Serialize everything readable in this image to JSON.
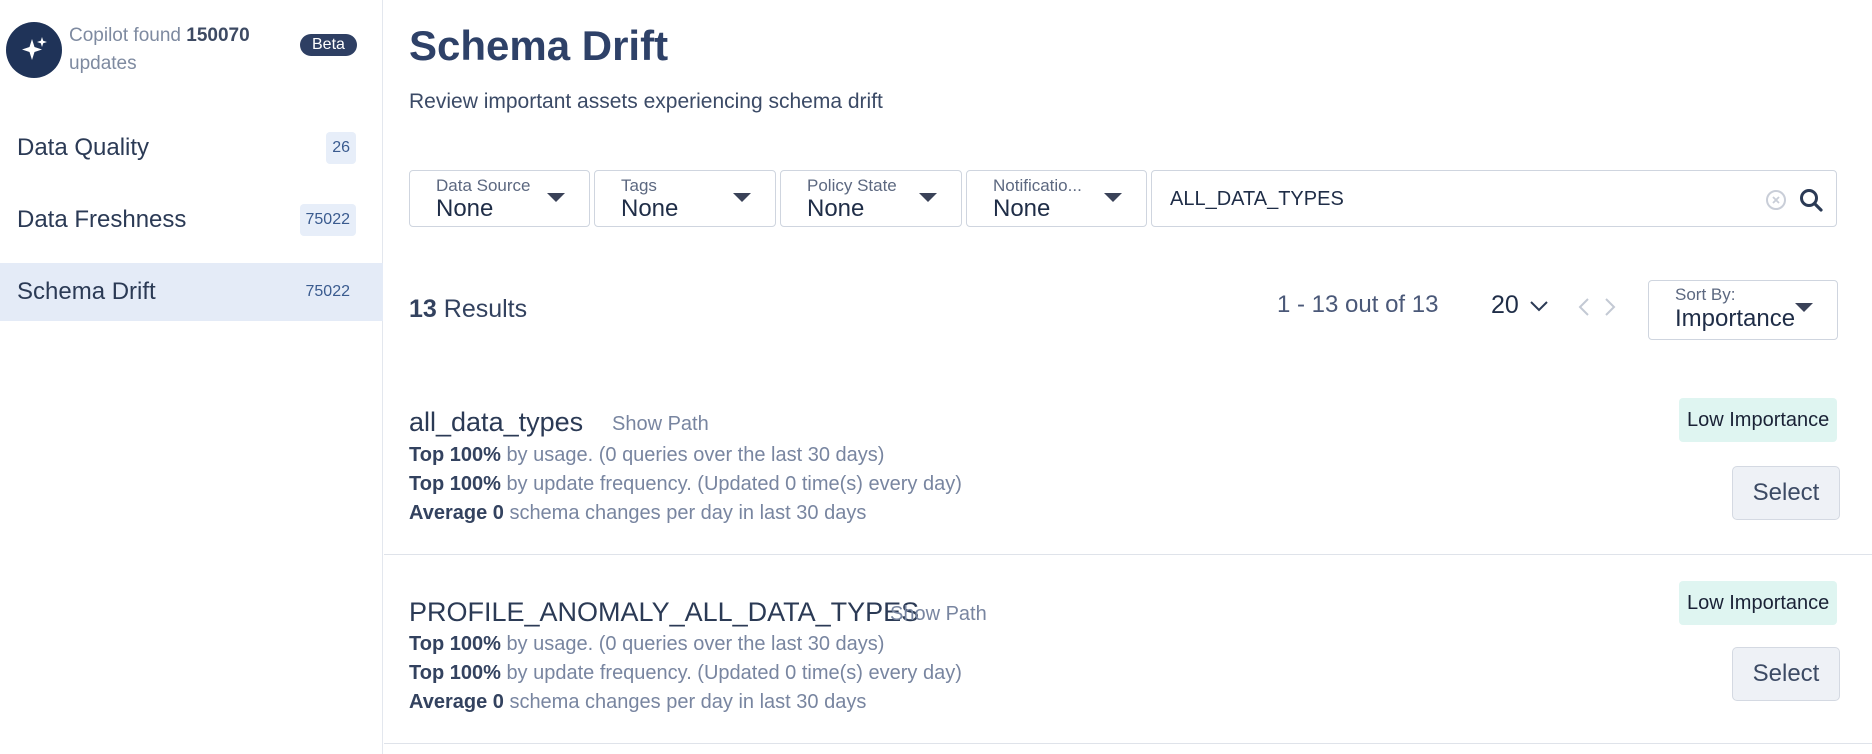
{
  "sidebar": {
    "copilot": {
      "prefix": "Copilot found",
      "count": "150070",
      "suffix": "updates",
      "badge": "Beta",
      "icon": "sparkle-icon"
    },
    "items": [
      {
        "label": "Data Quality",
        "count": "26",
        "active": false
      },
      {
        "label": "Data Freshness",
        "count": "75022",
        "active": false
      },
      {
        "label": "Schema Drift",
        "count": "75022",
        "active": true
      }
    ]
  },
  "header": {
    "title": "Schema Drift",
    "subtitle": "Review important assets experiencing schema drift"
  },
  "filters": [
    {
      "label": "Data Source",
      "value": "None"
    },
    {
      "label": "Tags",
      "value": "None"
    },
    {
      "label": "Policy State",
      "value": "None"
    },
    {
      "label": "Notificatio...",
      "value": "None"
    }
  ],
  "search": {
    "value": "ALL_DATA_TYPES",
    "placeholder": ""
  },
  "results": {
    "count": "13",
    "label": "Results",
    "range": "1 - 13 out of 13",
    "page_size": "20",
    "sort_label": "Sort By:",
    "sort_value": "Importance"
  },
  "items": [
    {
      "name": "all_data_types",
      "show_path": "Show Path",
      "importance": "Low Importance",
      "select": "Select",
      "usage_bold": "Top 100%",
      "usage_rest": "by usage. (0 queries over the last 30 days)",
      "freq_bold": "Top 100%",
      "freq_rest": "by update frequency. (Updated 0 time(s) every day)",
      "avg_bold": "Average 0",
      "avg_rest": "schema changes per day in last 30 days"
    },
    {
      "name": "PROFILE_ANOMALY_ALL_DATA_TYPES",
      "show_path": "Show Path",
      "importance": "Low Importance",
      "select": "Select",
      "usage_bold": "Top 100%",
      "usage_rest": "by usage. (0 queries over the last 30 days)",
      "freq_bold": "Top 100%",
      "freq_rest": "by update frequency. (Updated 0 time(s) every day)",
      "avg_bold": "Average 0",
      "avg_rest": "schema changes per day in last 30 days"
    }
  ],
  "colors": {
    "accent": "#2e4168",
    "active_nav": "#e4ebf7",
    "badge_bg": "#dff5f1",
    "logo_bg": "#1f3358"
  }
}
